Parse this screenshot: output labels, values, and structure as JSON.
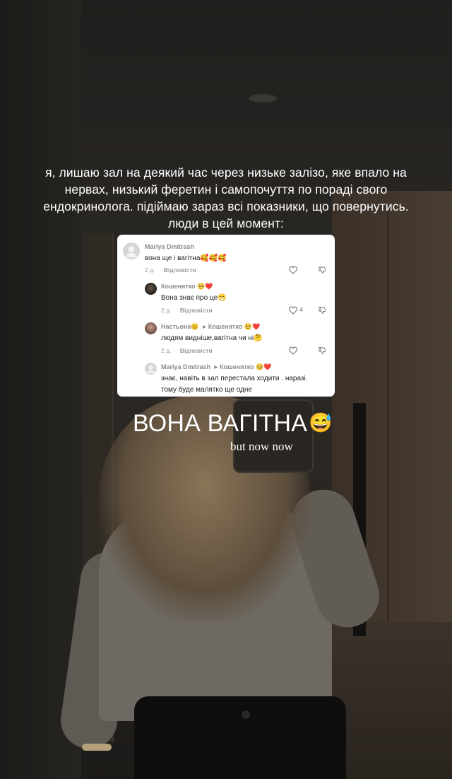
{
  "story": {
    "caption": "я, лишаю зал на деякий час через низьке залізо, яке впало на нервах, низький феретин і самопочуття по пораді свого ендокринолога. підіймаю зараз всі показники, що повернутись. люди в цей момент:",
    "title": "ВОНА ВАГІТНА",
    "title_emoji": "😅",
    "subtitle": "but now now"
  },
  "comments": [
    {
      "author": "Mariya Dmitrash",
      "reply_to": "",
      "reply_to_emoji": "",
      "author_emoji": "",
      "text": "вона ще і вагітна🥰🥰🥰",
      "time": "2 д.",
      "reply_label": "Відповісти",
      "likes": "",
      "avatar_color": "#d3d3d3"
    },
    {
      "author": "Кошенятко",
      "author_emoji": "🥺❤️",
      "reply_to": "",
      "reply_to_emoji": "",
      "text": "Вона знає про це😁",
      "time": "2 д.",
      "reply_label": "Відповісти",
      "likes": "4",
      "avatar_color": "#2a2826"
    },
    {
      "author": "Настьона",
      "author_emoji": "😊",
      "reply_to": "Кошенятко",
      "reply_to_emoji": "🥺❤️",
      "text": "людям видніше,вагітна чи ні🤔",
      "time": "2 д.",
      "reply_label": "Відповісти",
      "likes": "",
      "avatar_color": "#8a6a5a"
    },
    {
      "author": "Mariya Dmitrash",
      "author_emoji": "",
      "reply_to": "Кошенятко",
      "reply_to_emoji": "🥺❤️",
      "text": "знає, навіть в зал перестала ходити . наразі.",
      "text2": "тому буде малятко ще одне",
      "avatar_color": "#d3d3d3"
    }
  ],
  "icons": {
    "like": "heart-outline-icon",
    "dislike": "thumbs-down-outline-icon",
    "reply_arrow": "triangle-right-icon"
  }
}
